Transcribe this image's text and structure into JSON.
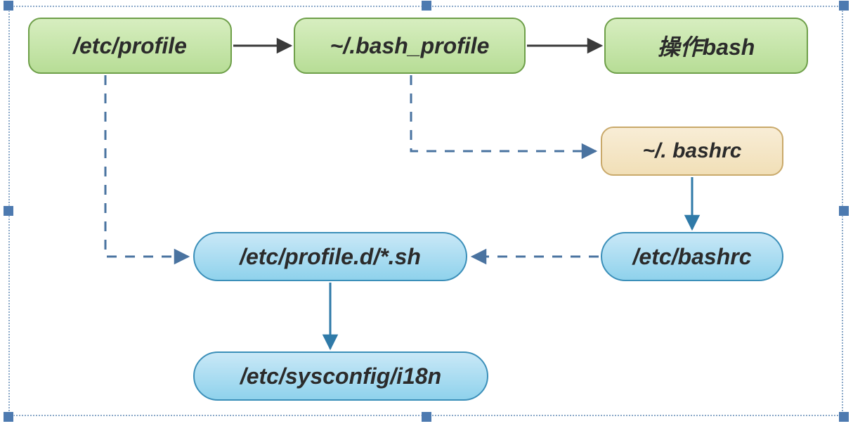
{
  "nodes": {
    "etc_profile": "/etc/profile",
    "bash_profile": "~/.bash_profile",
    "operate_bash": "操作bash",
    "bashrc_home": "~/. bashrc",
    "etc_bashrc": "/etc/bashrc",
    "profile_d": "/etc/profile.d/*.sh",
    "sysconfig_i18n": "/etc/sysconfig/i18n"
  },
  "colors": {
    "green_fill": "#b7dd96",
    "tan_fill": "#f1dfb7",
    "blue_fill": "#8fd2ec",
    "arrow_solid": "#3a3a3a",
    "arrow_dash": "#4a73a0",
    "arrow_blue_solid": "#2f7aa8"
  }
}
